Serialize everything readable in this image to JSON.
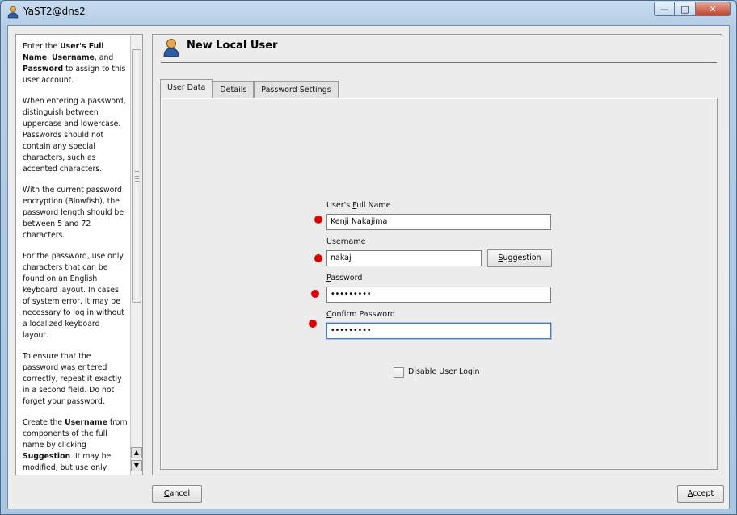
{
  "window": {
    "title": "YaST2@dns2",
    "minimize_label": "—",
    "maximize_label": "□",
    "close_label": "✕"
  },
  "help": {
    "paragraphs": [
      "Enter the User's Full Name, Username, and Password to assign to this user account.",
      "When entering a password, distinguish between uppercase and lowercase. Passwords should not contain any special characters, such as accented characters.",
      "With the current password encryption (Blowfish), the password length should be between 5 and 72 characters.",
      "For the password, use only characters that can be found on an English keyboard layout. In cases of system error, it may be necessary to log in without a localized keyboard layout.",
      "To ensure that the password was entered correctly, repeat it exactly in a second field. Do not forget your password.",
      "Create the Username from components of the full name by clicking Suggestion. It may be modified, but use only letters (no accented characters), digits,"
    ],
    "p1": {
      "a": "Enter the ",
      "b1": "User's Full Name",
      "c": ", ",
      "b2": "Username",
      "d": ", and ",
      "b3": "Password",
      "e": " to assign to this user account."
    },
    "p6": {
      "a": "Create the ",
      "b1": "Username",
      "c": " from components of the full name by clicking ",
      "b2": "Suggestion",
      "d": ". It may be modified, but use only letters (no accented characters), digits,"
    },
    "scroll_up": "▲",
    "scroll_down": "▼"
  },
  "main": {
    "heading": "New Local User",
    "tabs": [
      "User Data",
      "Details",
      "Password Settings"
    ],
    "active_tab": "User Data"
  },
  "form": {
    "full_name": {
      "label_pre": "User's ",
      "label_u": "F",
      "label_post": "ull Name",
      "value": "Kenji Nakajima"
    },
    "username": {
      "label_pre": "",
      "label_u": "U",
      "label_post": "sername",
      "value": "nakaj"
    },
    "suggestion_button": {
      "pre": "",
      "u": "S",
      "post": "uggestion"
    },
    "password": {
      "label_pre": "",
      "label_u": "P",
      "label_post": "assword",
      "value": "•••••••••"
    },
    "confirm_password": {
      "label_pre": "",
      "label_u": "C",
      "label_post": "onfirm Password",
      "value": "•••••••••"
    },
    "disable_login": {
      "pre": "D",
      "u": "i",
      "post": "sable User Login",
      "checked": false
    }
  },
  "footer": {
    "cancel": {
      "u": "C",
      "post": "ancel"
    },
    "accept": {
      "u": "A",
      "post": "ccept"
    }
  },
  "colors": {
    "required_marker": "#e00000",
    "focus_border": "#3d7bd6"
  }
}
